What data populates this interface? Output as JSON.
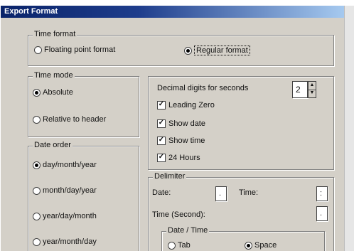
{
  "window": {
    "title": "Export Format"
  },
  "time_format": {
    "legend": "Time format",
    "options": [
      {
        "label": "Floating point format",
        "selected": false
      },
      {
        "label": "Regular format",
        "selected": true
      }
    ]
  },
  "time_mode": {
    "legend": "Time mode",
    "options": [
      {
        "label": "Absolute",
        "selected": true
      },
      {
        "label": "Relative to header",
        "selected": false
      }
    ]
  },
  "date_order": {
    "legend": "Date order",
    "options": [
      {
        "label": "day/month/year",
        "selected": true
      },
      {
        "label": "month/day/year",
        "selected": false
      },
      {
        "label": "year/day/month",
        "selected": false
      },
      {
        "label": "year/month/day",
        "selected": false
      }
    ]
  },
  "display": {
    "decimal_label": "Decimal digits for seconds",
    "decimal_value": "2",
    "checks": [
      {
        "label": "Leading Zero",
        "checked": true
      },
      {
        "label": "Show date",
        "checked": true
      },
      {
        "label": "Show time",
        "checked": true
      },
      {
        "label": "24 Hours",
        "checked": true
      }
    ]
  },
  "delimiter": {
    "legend": "Delimiter",
    "date_label": "Date:",
    "date_value": ".",
    "time_label": "Time:",
    "time_value": ":",
    "seconds_label": "Time (Second):",
    "seconds_value": ".",
    "date_time": {
      "legend": "Date / Time",
      "options": [
        {
          "label": "Tab",
          "selected": false
        },
        {
          "label": "Space",
          "selected": true
        }
      ]
    }
  }
}
